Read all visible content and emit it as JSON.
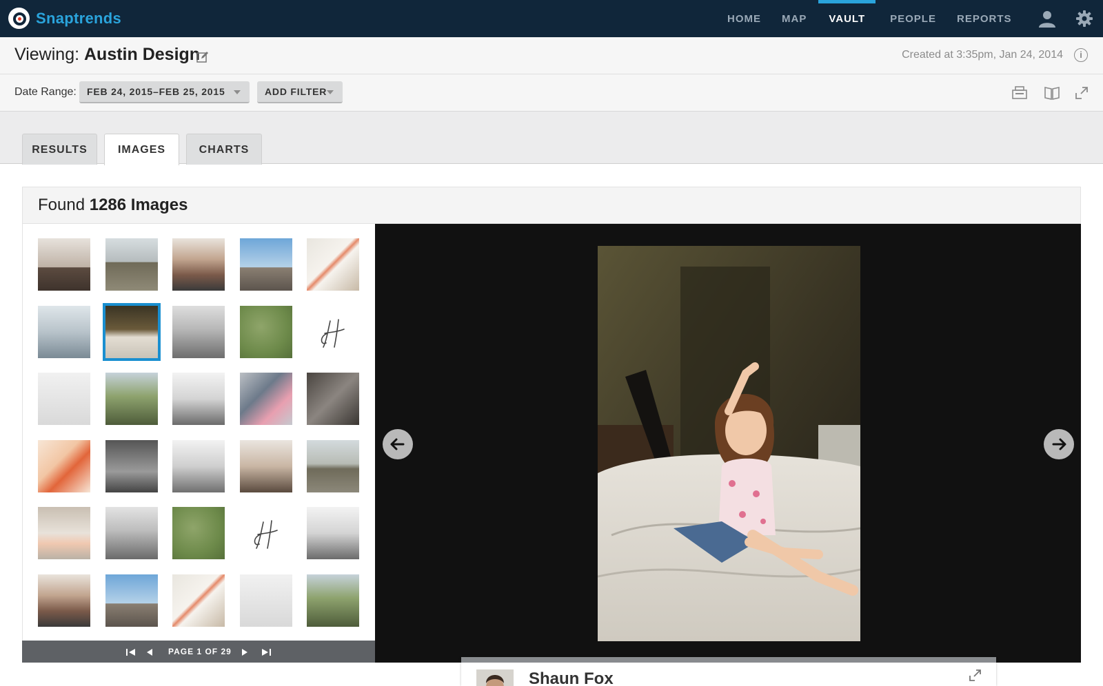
{
  "app": {
    "name": "Snaptrends"
  },
  "nav": {
    "items": [
      {
        "label": "HOME",
        "active": false
      },
      {
        "label": "MAP",
        "active": false
      },
      {
        "label": "VAULT",
        "active": true
      },
      {
        "label": "PEOPLE",
        "active": false
      },
      {
        "label": "REPORTS",
        "active": false
      }
    ],
    "icons": [
      "user-icon",
      "gear-icon"
    ]
  },
  "viewing": {
    "prefix": "Viewing:",
    "name": "Austin Design",
    "created": "Created at 3:35pm, Jan 24, 2014"
  },
  "filters": {
    "date_range_label": "Date Range:",
    "date_range_value": "FEB 24, 2015–FEB 25, 2015",
    "add_filter_label": "ADD FILTER"
  },
  "tabs": [
    {
      "label": "RESULTS",
      "active": false
    },
    {
      "label": "IMAGES",
      "active": true
    },
    {
      "label": "CHARTS",
      "active": false
    }
  ],
  "results": {
    "found_prefix": "Found",
    "found_count": "1286 Images"
  },
  "thumbnails": {
    "selected_index": 6,
    "count": 30
  },
  "pager": {
    "text": "PAGE 1 OF 29"
  },
  "user_card": {
    "name": "Shaun Fox"
  },
  "colors": {
    "topbar": "#10263a",
    "accent": "#2aa4dc",
    "selected_outline": "#1a8fd0",
    "viewer_bg": "#111111"
  }
}
